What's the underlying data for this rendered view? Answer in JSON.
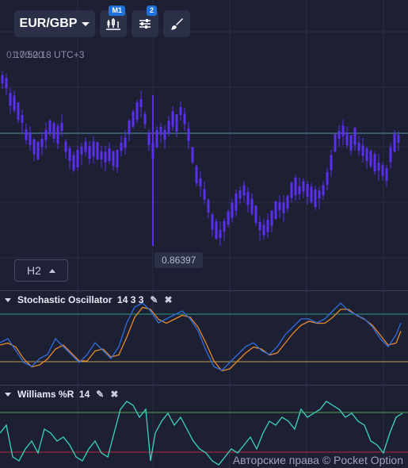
{
  "toolbar": {
    "pair_label": "EUR/GBP",
    "timeframe_badge": "M1",
    "indicators_badge": "2"
  },
  "chart": {
    "time_label": "17:52:18 UTC+3",
    "time_label_ghost": "01:00:00",
    "price_label": "0.86397",
    "timeframe_button": "H2",
    "candle_color": "#5b2ff0",
    "price_line_color": "#4e9aa8"
  },
  "panels": {
    "stochastic": {
      "title": "Stochastic Oscillator",
      "params": "14 3 3",
      "k_color": "#2f6fe0",
      "d_color": "#e58a2a",
      "upper_color": "#2e9c83",
      "lower_color": "#c0a14a"
    },
    "williams": {
      "title": "Williams %R",
      "params": "14",
      "line_color": "#3ad6c0",
      "upper_color": "#5aa34a",
      "lower_color": "#b82b36"
    }
  },
  "footer": {
    "copyright": "Авторские права © Pocket Option"
  }
}
